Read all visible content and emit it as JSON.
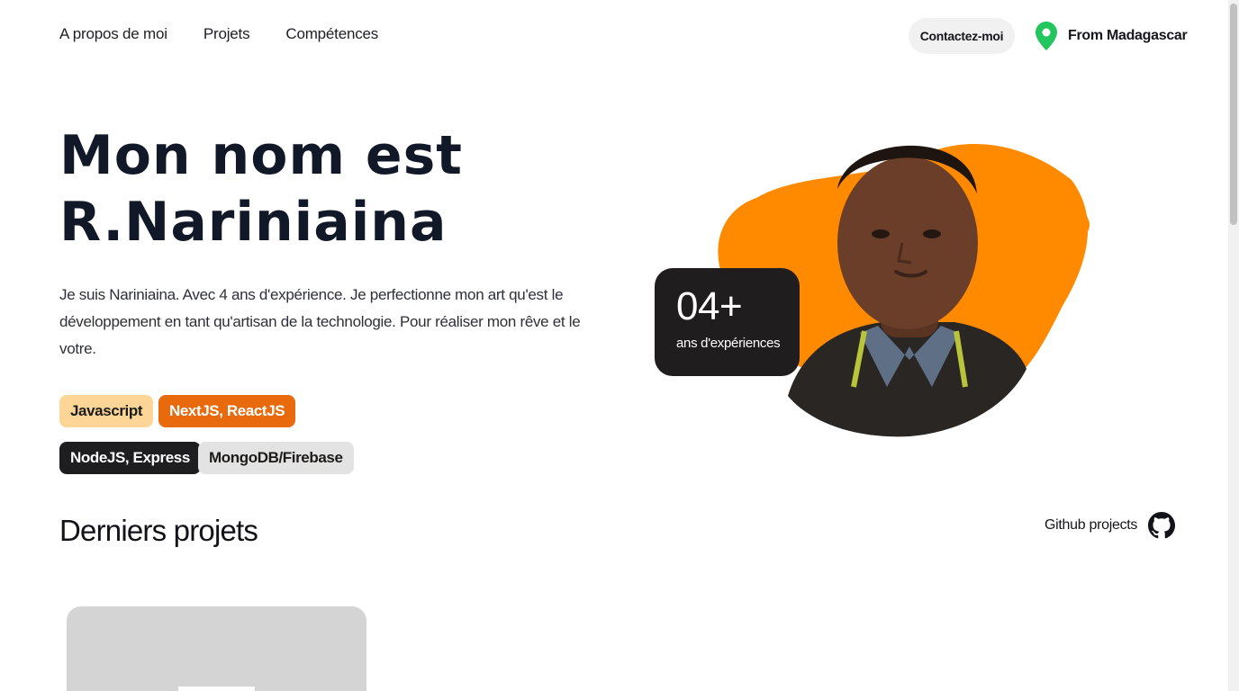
{
  "nav": {
    "items": [
      {
        "label": "A propos de moi"
      },
      {
        "label": "Projets"
      },
      {
        "label": "Compétences"
      }
    ],
    "contact_label": "Contactez-moi",
    "location": {
      "text": "From Madagascar",
      "icon": "location-pin-icon",
      "color": "#22c55e"
    }
  },
  "hero": {
    "title_line1": "Mon nom est",
    "title_line2": "R.Nariniaina",
    "description": "Je suis Nariniaina. Avec 4 ans d'expérience. Je perfectionne mon art qu'est le développement en tant qu'artisan de la technologie. Pour réaliser mon rêve et le votre.",
    "tags": [
      {
        "label": "Javascript",
        "color": "#fdd596"
      },
      {
        "label": "NextJS, ReactJS",
        "color": "#e9690d"
      },
      {
        "label": "NodeJS, Express",
        "color": "#1e1d1f"
      },
      {
        "label": "MongoDB/Firebase",
        "color": "#e3e3e4"
      }
    ],
    "experience": {
      "value": "04+",
      "label": "ans d'expériences"
    },
    "accent_color": "#ff8a00"
  },
  "projects": {
    "title": "Derniers projets",
    "github_label": "Github projects",
    "github_icon": "github-icon"
  }
}
